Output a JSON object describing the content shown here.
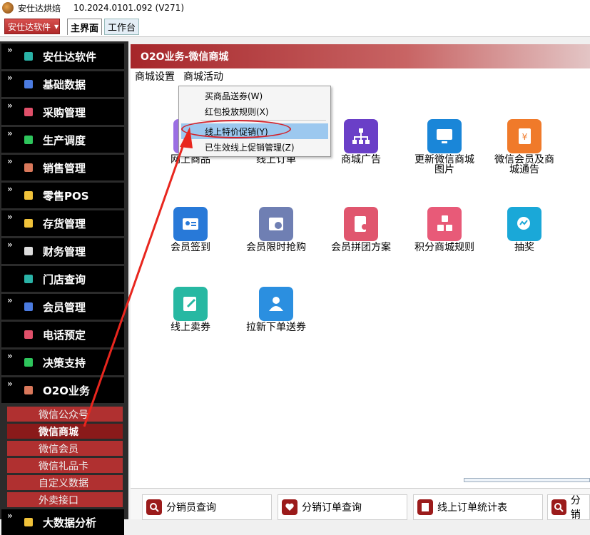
{
  "window": {
    "title": "安仕达烘焙",
    "version": "10.2024.0101.092 (V271)"
  },
  "menubar": {
    "brand": "安仕达软件",
    "tabs": [
      {
        "label": "主界面"
      },
      {
        "label": "工作台"
      }
    ]
  },
  "sidebar": {
    "items": [
      {
        "label": "安仕达软件",
        "color": "#2ab3a7"
      },
      {
        "label": "基础数据",
        "color": "#4b7be0"
      },
      {
        "label": "采购管理",
        "color": "#e0506a"
      },
      {
        "label": "生产调度",
        "color": "#2ec55c"
      },
      {
        "label": "销售管理",
        "color": "#d9785b"
      },
      {
        "label": "零售POS",
        "color": "#f0c23a"
      },
      {
        "label": "存货管理",
        "color": "#f0c23a"
      },
      {
        "label": "财务管理",
        "color": "#dddddd"
      },
      {
        "label": "门店查询",
        "color": "#2ab3a7"
      },
      {
        "label": "会员管理",
        "color": "#4b7be0"
      },
      {
        "label": "电话预定",
        "color": "#e0506a"
      },
      {
        "label": "决策支持",
        "color": "#2ec55c"
      },
      {
        "label": "O2O业务",
        "color": "#d9785b"
      },
      {
        "label": "大数据分析",
        "color": "#f0c23a"
      }
    ],
    "subitems": [
      {
        "label": "微信公众号"
      },
      {
        "label": "微信商城"
      },
      {
        "label": "微信会员"
      },
      {
        "label": "微信礼品卡"
      },
      {
        "label": "自定义数据"
      },
      {
        "label": "外卖接口"
      }
    ]
  },
  "content": {
    "header": "O2O业务-微信商城",
    "menu": [
      {
        "label": "商城设置"
      },
      {
        "label": "商城活动"
      }
    ],
    "dropdown": [
      {
        "label": "买商品送券(W)"
      },
      {
        "label": "红包投放规则(X)"
      },
      {
        "label": "线上特价促销(Y)"
      },
      {
        "label": "已生效线上促销管理(Z)"
      }
    ],
    "apps": [
      {
        "label": "网上商品",
        "color": "#9b6fe3",
        "icon": "goods-icon"
      },
      {
        "label": "线上订单",
        "color": "#3a8ee6",
        "icon": "order-icon"
      },
      {
        "label": "商城广告",
        "color": "#6a3fc7",
        "icon": "org-chart-icon"
      },
      {
        "label": "更新微信商城图片",
        "color": "#1a86d8",
        "icon": "monitor-icon"
      },
      {
        "label": "微信会员及商城通告",
        "color": "#f07a2a",
        "icon": "money-book-icon"
      },
      {
        "label": "会员签到",
        "color": "#2879d8",
        "icon": "id-card-icon"
      },
      {
        "label": "会员限时抢购",
        "color": "#6f7fb3",
        "icon": "clock-doc-icon"
      },
      {
        "label": "会员拼团方案",
        "color": "#e0566e",
        "icon": "doc-person-icon"
      },
      {
        "label": "积分商城规则",
        "color": "#e85a78",
        "icon": "abc-icon"
      },
      {
        "label": "抽奖",
        "color": "#1aa8d8",
        "icon": "chart-search-icon"
      },
      {
        "label": "线上卖券",
        "color": "#27b8a2",
        "icon": "edit-icon"
      },
      {
        "label": "拉新下单送券",
        "color": "#2b8fe0",
        "icon": "group-icon"
      }
    ]
  },
  "bottombar": {
    "buttons": [
      {
        "label": "分销员查询"
      },
      {
        "label": "分销订单查询"
      },
      {
        "label": "线上订单统计表"
      },
      {
        "label": "分销"
      }
    ]
  }
}
